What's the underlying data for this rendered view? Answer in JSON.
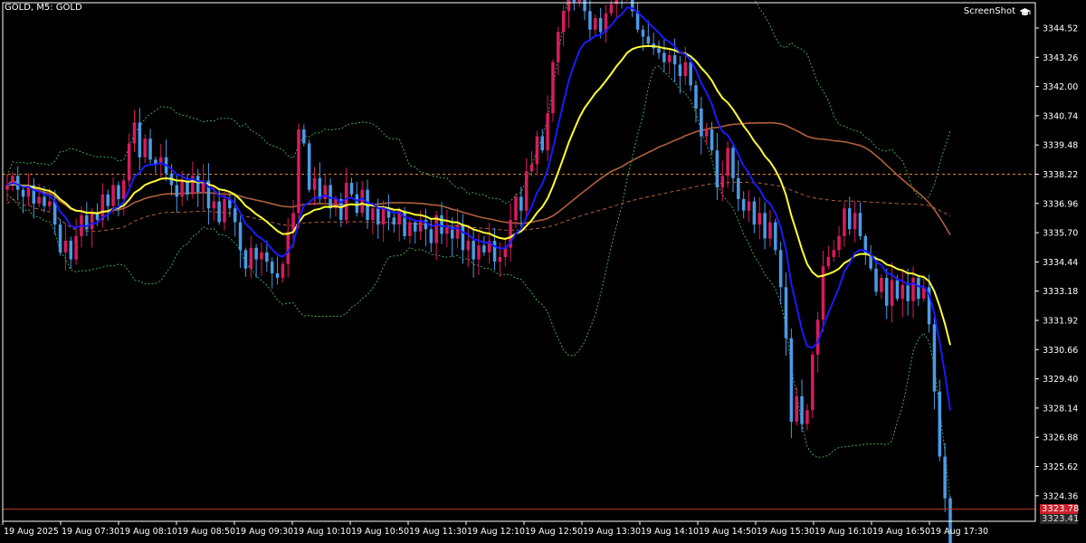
{
  "window": {
    "title": "GOLD, M5:  GOLD",
    "screenshot_label": "ScreenShot",
    "screenshot_icon": "graduation-cap-icon"
  },
  "colors": {
    "background": "#000000",
    "frame": "#ffffff",
    "bull_body": "#d81b60",
    "bear_body": "#4a9be8",
    "ma_fast": "#1a1aff",
    "ma_mid": "#ffff33",
    "ma_slow": "#b0603a",
    "ma_long": "#b0603a",
    "bands": "#3fa35b",
    "level_dashed": "#e08a2e",
    "bid_line": "#c0392b",
    "bid_tag_bg": "#cc1f2a",
    "last_tag_bg": "#2a2a2a",
    "neutral_cross": "#39c95a"
  },
  "price_axis": {
    "labels": [
      "3344.52",
      "3343.26",
      "3342.00",
      "3340.74",
      "3339.48",
      "3338.22",
      "3336.96",
      "3335.70",
      "3334.44",
      "3333.18",
      "3331.92",
      "3330.66",
      "3329.40",
      "3328.14",
      "3326.88",
      "3325.62",
      "3324.36"
    ],
    "ylim": [
      3323.41,
      3344.52
    ],
    "current_bid": "3323.78",
    "current_last": "3323.41",
    "level_price": 3338.22
  },
  "time_axis": {
    "labels": [
      "19 Aug 2025",
      "19 Aug 07:30",
      "19 Aug 08:10",
      "19 Aug 08:50",
      "19 Aug 09:30",
      "19 Aug 10:10",
      "19 Aug 10:50",
      "19 Aug 11:30",
      "19 Aug 12:10",
      "19 Aug 12:50",
      "19 Aug 13:30",
      "19 Aug 14:10",
      "19 Aug 14:50",
      "19 Aug 15:30",
      "19 Aug 16:10",
      "19 Aug 16:50",
      "19 Aug 17:30"
    ]
  },
  "chart_data": {
    "type": "candlestick",
    "symbol": "GOLD",
    "timeframe": "M5",
    "start_price": 3337.55,
    "steps": [
      0.2,
      0.4,
      -0.6,
      -0.3,
      0.5,
      -0.8,
      0.3,
      -0.4,
      0.2,
      -1.0,
      -1.2,
      0.5,
      -0.8,
      1.0,
      0.9,
      -0.6,
      0.7,
      -0.3,
      1.1,
      -0.5,
      0.9,
      -0.6,
      0.8,
      1.6,
      0.9,
      -1.5,
      0.8,
      -0.9,
      -0.2,
      0.3,
      -0.7,
      -0.5,
      -0.5,
      0.7,
      -0.6,
      0.8,
      -0.7,
      0.5,
      -1.2,
      0.3,
      -0.9,
      1.0,
      -0.4,
      -0.6,
      -1.2,
      -0.8,
      0.9,
      -0.5,
      0.3,
      -0.4,
      -0.5,
      -0.2,
      0.6,
      1.4,
      0.8,
      3.6,
      -0.6,
      -2.0,
      0.5,
      -0.9,
      0.6,
      -1.0,
      0.4,
      -0.9,
      1.6,
      -0.5,
      -0.8,
      1.0,
      -1.3,
      0.5,
      -0.7,
      0.7,
      -0.4,
      -0.3,
      0.6,
      -1.1,
      0.6,
      -0.4,
      0.5,
      -0.4,
      -0.6,
      1.2,
      -0.8,
      0.3,
      -0.5,
      0.6,
      -1.1,
      0.4,
      -0.8,
      0.6,
      -0.3,
      0.5,
      -0.9,
      0.2,
      0.4,
      1.2,
      1.0,
      -0.6,
      1.7,
      0.3,
      1.2,
      -0.6,
      1.6,
      2.2,
      1.3,
      0.9,
      0.8,
      -0.4,
      0.3,
      -0.7,
      -0.8,
      0.5,
      -0.6,
      0.8,
      0.4,
      0.6,
      -0.3,
      0.7,
      -1.3,
      -0.8,
      -0.3,
      -0.3,
      -0.2,
      -0.2,
      -0.4,
      0.3,
      -0.4,
      -0.5,
      0.6,
      -1.0,
      -1.0,
      -1.2,
      0.3,
      -0.9,
      -1.6,
      0.5,
      1.2,
      -1.3,
      -0.9,
      -0.5,
      0.4,
      -1.0,
      0.5,
      -1.1,
      0.7,
      -1.2,
      -1.6,
      -2.2,
      -3.6,
      1.1,
      -1.2,
      0.6,
      2.4,
      1.5,
      2.3,
      0.4,
      0.3,
      0.6,
      1.2,
      -0.9,
      0.7,
      -1.0,
      -0.8,
      -0.6,
      -1.0,
      0.6,
      -1.2,
      1.1,
      -0.8,
      0.6,
      -0.7,
      1.0,
      -0.9,
      0.5,
      -1.6,
      -2.9,
      -2.8,
      -1.8,
      -2.6
    ]
  }
}
